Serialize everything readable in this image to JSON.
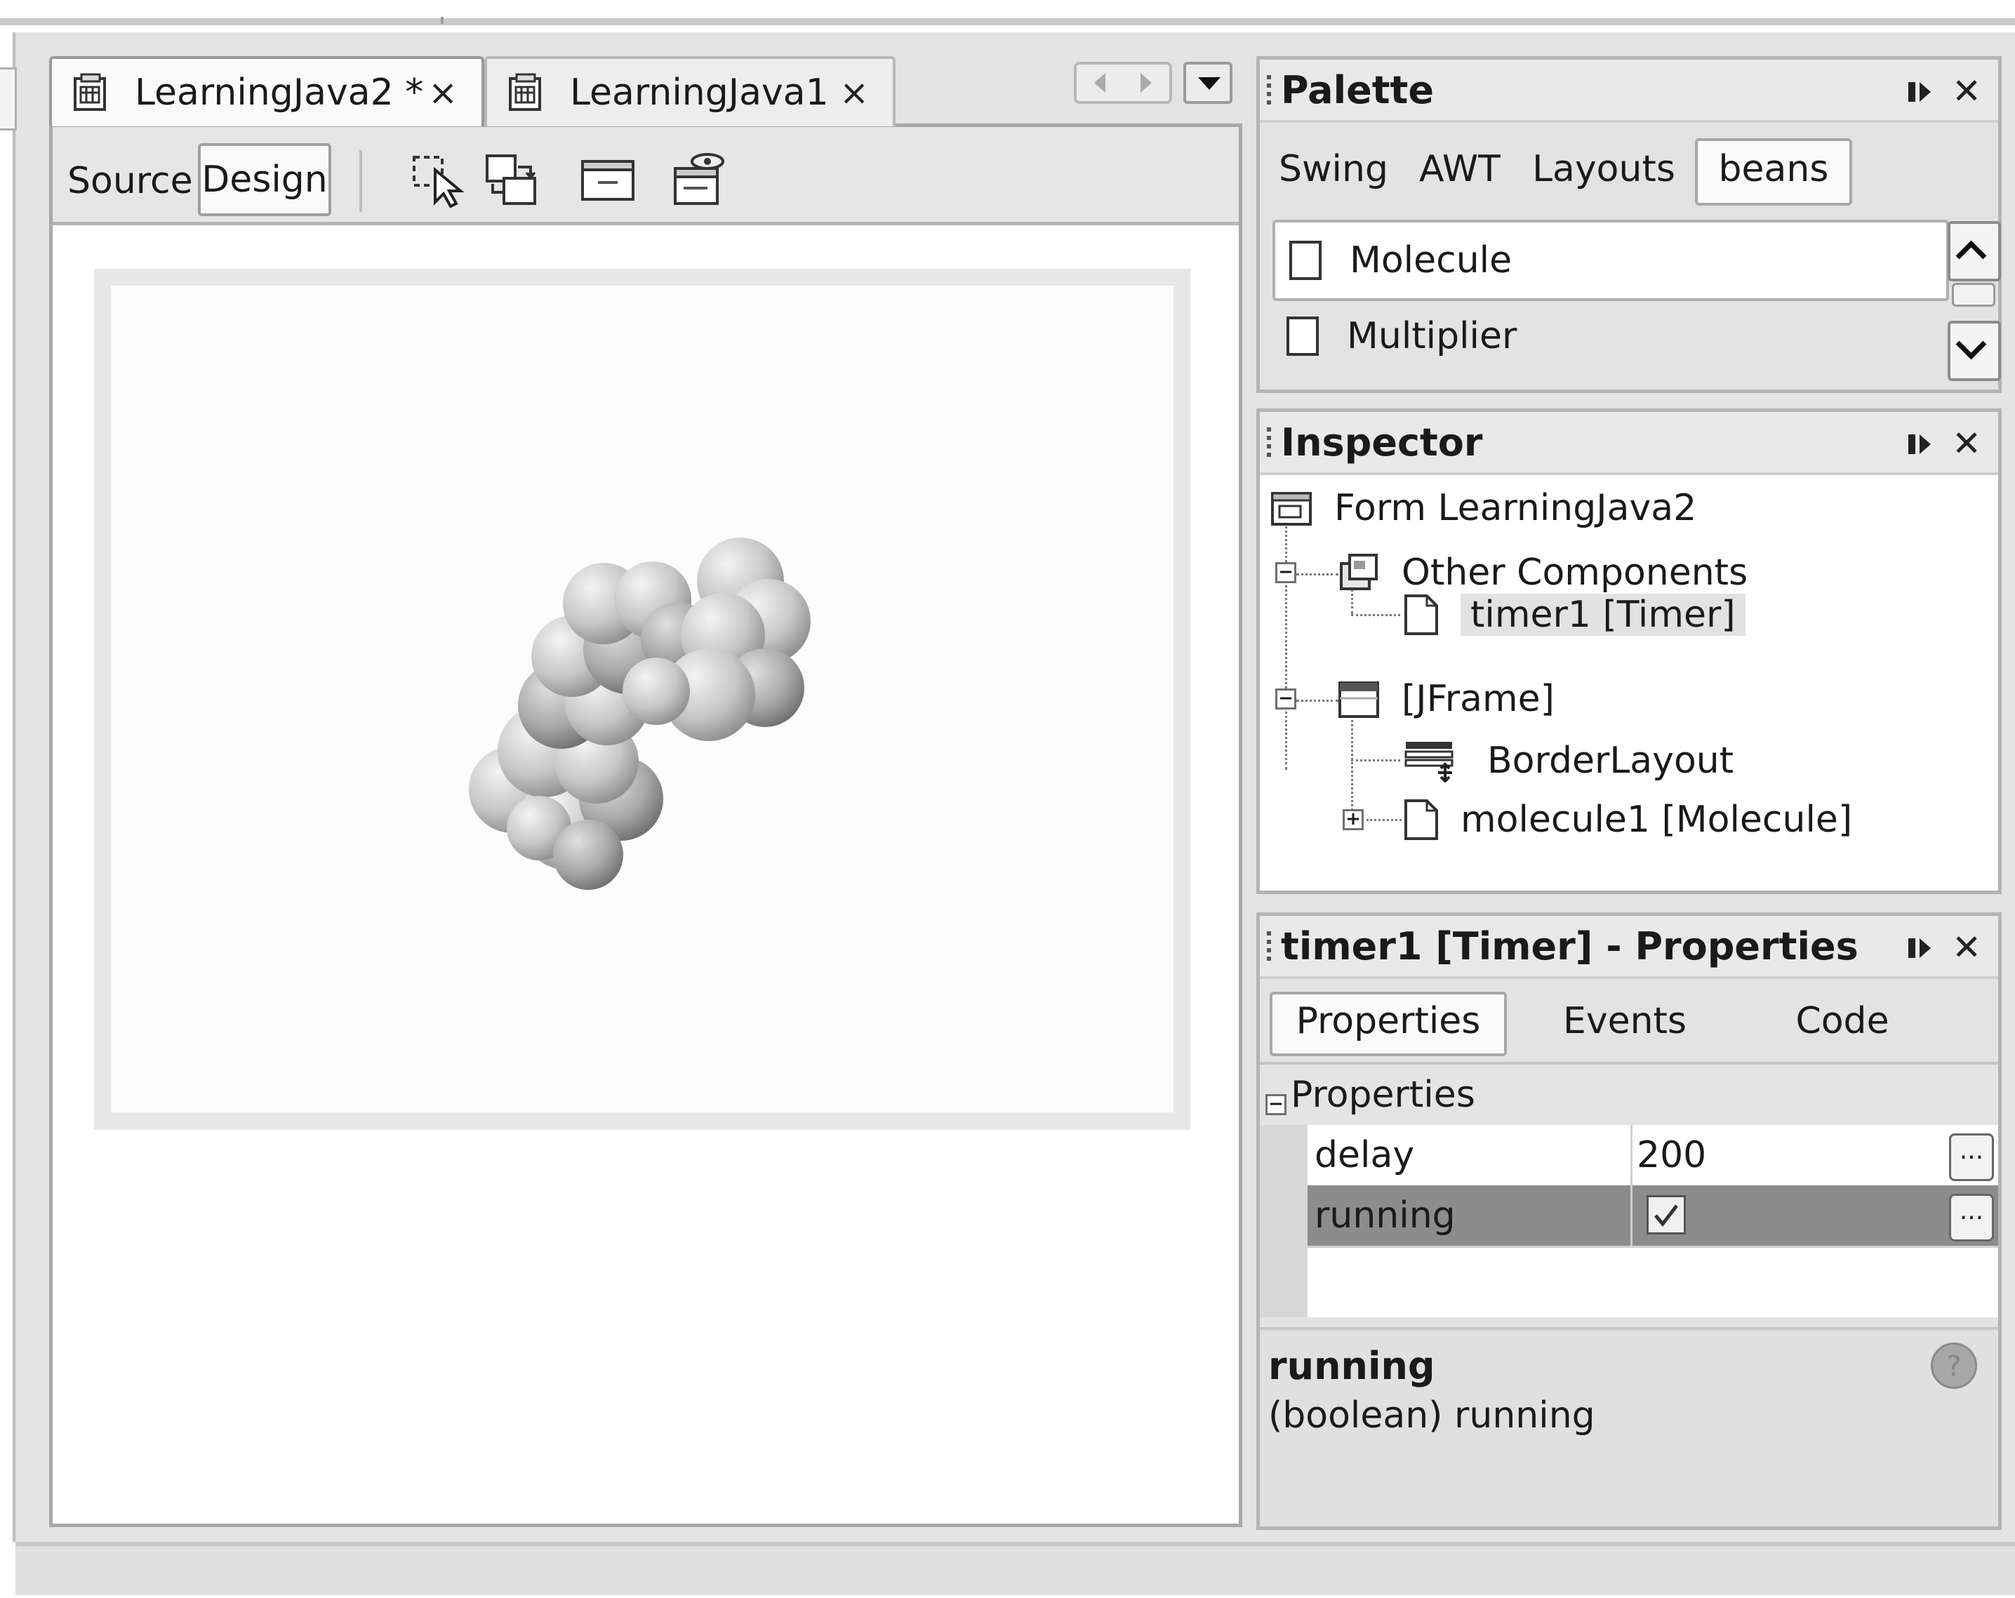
{
  "editor": {
    "tabs": [
      {
        "label": "LearningJava2 *",
        "close": "×"
      },
      {
        "label": "LearningJava1",
        "close": "×"
      }
    ],
    "view_buttons": {
      "source": "Source",
      "design": "Design"
    },
    "toolbar_icons": [
      "selection-mode-icon",
      "connection-mode-icon",
      "preview-design-icon",
      "test-form-icon"
    ]
  },
  "palette": {
    "title": "Palette",
    "tabs": [
      "Swing",
      "AWT",
      "Layouts",
      "beans"
    ],
    "active_tab": "beans",
    "items": [
      "Molecule",
      "Multiplier"
    ],
    "selected_item": "Molecule"
  },
  "inspector": {
    "title": "Inspector",
    "tree": {
      "form": "Form LearningJava2",
      "other_components": "Other Components",
      "timer": "timer1 [Timer]",
      "jframe": "[JFrame]",
      "border_layout": "BorderLayout",
      "molecule": "molecule1 [Molecule]"
    },
    "selected_node": "timer1 [Timer]"
  },
  "properties": {
    "title": "timer1 [Timer] - Properties",
    "tabs": [
      "Properties",
      "Events",
      "Code"
    ],
    "active_tab": "Properties",
    "section": "Properties",
    "rows": [
      {
        "name": "delay",
        "value": "200",
        "button": "..."
      },
      {
        "name": "running",
        "value_checked": true,
        "button": "..."
      }
    ],
    "selected_row": "running",
    "description": {
      "title": "running",
      "text": "(boolean)  running"
    }
  },
  "colors": {
    "panel_bg": "#e3e3e3",
    "selected_row": "#8c8c8c",
    "canvas_frame": "#e7e7e7"
  }
}
